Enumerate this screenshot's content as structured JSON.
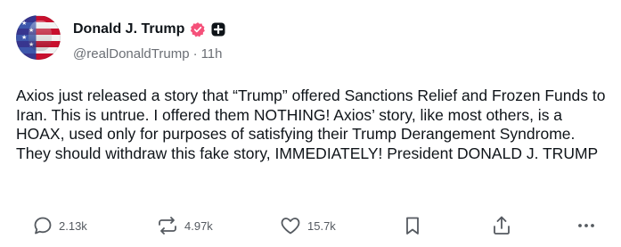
{
  "author": {
    "display_name": "Donald J. Trump",
    "handle": "@realDonaldTrump",
    "separator": "·",
    "time_ago": "11h",
    "verified_badge_color": "#f5517a"
  },
  "post": {
    "text": "Axios just released a story that “Trump” offered Sanctions Relief and Frozen Funds to Iran. This is untrue. I offered them NOTHING! Axios’ story, like most others, is a HOAX, used only for purposes of satisfying their Trump Derangement Syndrome. They should withdraw this fake story, IMMEDIATELY! President DONALD J. TRUMP"
  },
  "actions": {
    "reply_count": "2.13k",
    "repost_count": "4.97k",
    "like_count": "15.7k",
    "icons": [
      "reply-icon",
      "repost-icon",
      "like-icon",
      "bookmark-icon",
      "share-icon",
      "more-icon"
    ]
  },
  "colors": {
    "text": "#0f1419",
    "muted": "#6b6f75",
    "icon": "#555a60"
  }
}
